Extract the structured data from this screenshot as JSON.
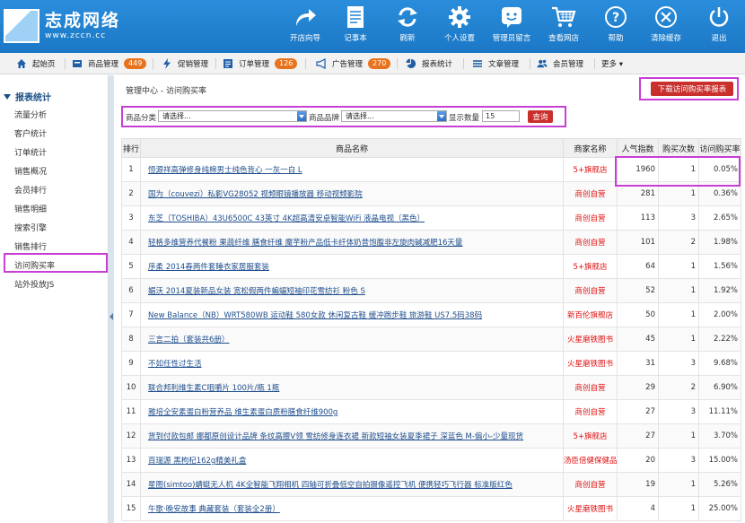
{
  "brand": {
    "name": "志成网络",
    "url": "www.zccn.cc"
  },
  "top_nav": [
    {
      "label": "开店向导",
      "icon": "share-arrow-icon"
    },
    {
      "label": "记事本",
      "icon": "notepad-icon"
    },
    {
      "label": "刷新",
      "icon": "refresh-icon"
    },
    {
      "label": "个人设置",
      "icon": "gear-icon"
    },
    {
      "label": "管理员留言",
      "icon": "message-icon"
    },
    {
      "label": "查看网店",
      "icon": "cart-icon"
    },
    {
      "label": "帮助",
      "icon": "help-icon"
    },
    {
      "label": "清除缓存",
      "icon": "close-circle-icon"
    },
    {
      "label": "退出",
      "icon": "power-icon"
    }
  ],
  "sec_nav": [
    {
      "label": "起始页",
      "icon": "home-icon"
    },
    {
      "label": "商品管理",
      "icon": "product-icon",
      "badge": "449"
    },
    {
      "label": "促销管理",
      "icon": "lightning-icon"
    },
    {
      "label": "订单管理",
      "icon": "order-icon",
      "badge": "126"
    },
    {
      "label": "广告管理",
      "icon": "megaphone-icon",
      "badge": "270"
    },
    {
      "label": "报表统计",
      "icon": "pie-chart-icon"
    },
    {
      "label": "文章管理",
      "icon": "list-icon"
    },
    {
      "label": "会员管理",
      "icon": "users-icon"
    },
    {
      "label": "更多 ▾",
      "icon": ""
    }
  ],
  "sidebar": {
    "title": "报表统计",
    "items": [
      "流量分析",
      "客户统计",
      "订单统计",
      "销售概况",
      "会员排行",
      "销售明细",
      "搜索引擎",
      "销售排行",
      "访问购买率",
      "站外投放JS"
    ]
  },
  "breadcrumb": "管理中心  -  访问购买率",
  "download_label": "下载访问购买率报表",
  "filter": {
    "category_label": "商品分类",
    "category_value": "请选择...",
    "brand_label": "商品品牌",
    "brand_value": "请选择...",
    "count_label": "显示数量",
    "count_value": "15",
    "query_label": "查询"
  },
  "table": {
    "headers": [
      "排行",
      "商品名称",
      "商家名称",
      "人气指数",
      "购买次数",
      "访问购买率"
    ],
    "rows": [
      [
        "1",
        "恒源祥高弹修身纯棉男士纯色背心 一灰一白 L",
        "5+旗舰店",
        "1960",
        "1",
        "0.05%"
      ],
      [
        "2",
        "国为（couvezi）私影VG28052 视频眼镜播放器 移动视频影院",
        "商创自营",
        "281",
        "1",
        "0.36%"
      ],
      [
        "3",
        "东芝（TOSHIBA）43U6500C 43英寸 4K超高清安卓智能WiFi 液晶电视（黑色）",
        "商创自营",
        "113",
        "3",
        "2.65%"
      ],
      [
        "4",
        "轻格多维营养代餐粉 果蔬纤维 膳食纤维 魔芋粉产品低卡纤体奶昔饱腹非左旋肉碱减肥16天量",
        "商创自营",
        "101",
        "2",
        "1.98%"
      ],
      [
        "5",
        "序柔 2014春两件套睡衣家居服套装",
        "5+旗舰店",
        "64",
        "1",
        "1.56%"
      ],
      [
        "6",
        "媚沃 2014夏装新品女装 宽松假两件蝙蝠短袖印花雪纺衫 粉色 S",
        "商创自营",
        "52",
        "1",
        "1.92%"
      ],
      [
        "7",
        "New Balance（NB）WRT580WB 运动鞋 580女款 休闲复古鞋 缓冲跑步鞋 旅游鞋 US7.5码38码",
        "新百伦旗舰店",
        "50",
        "1",
        "2.00%"
      ],
      [
        "8",
        "三言二拍（套装共6册）",
        "火星磨铁图书",
        "45",
        "1",
        "2.22%"
      ],
      [
        "9",
        "不如任性过生活",
        "火星磨铁图书",
        "31",
        "3",
        "9.68%"
      ],
      [
        "10",
        "联合邦利维生素C咀嚼片 100片/瓶 1瓶",
        "商创自营",
        "29",
        "2",
        "6.90%"
      ],
      [
        "11",
        "雅培全安素蛋白粉营养品 维生素蛋白质粉膳食纤维900g",
        "商创自营",
        "27",
        "3",
        "11.11%"
      ],
      [
        "12",
        "货到付款包邮 娜都原创设计品牌 条纹高腰V领 雪纺修身连衣裙 新款短袖女装夏季裙子 深蓝色 M-偏小-少量现货",
        "5+旗舰店",
        "27",
        "1",
        "3.70%"
      ],
      [
        "13",
        "百瑞源 黑枸杞162g精美礼盒",
        "汤臣倍健保健品",
        "20",
        "3",
        "15.00%"
      ],
      [
        "14",
        "星图(simtoo)蜻蜓无人机 4K全智能飞翔相机 四轴可折叠低空自拍摄像遥控飞机 便携轻巧飞行器 标准版红色",
        "商创自营",
        "19",
        "1",
        "5.26%"
      ],
      [
        "15",
        "午歌·晚安故事 典藏套装（套装全2册）",
        "火星磨铁图书",
        "4",
        "1",
        "25.00%"
      ]
    ]
  },
  "colors": {
    "header_blue": "#1f82d2",
    "accent_red": "#c9302c",
    "highlight": "#c83fd4"
  }
}
